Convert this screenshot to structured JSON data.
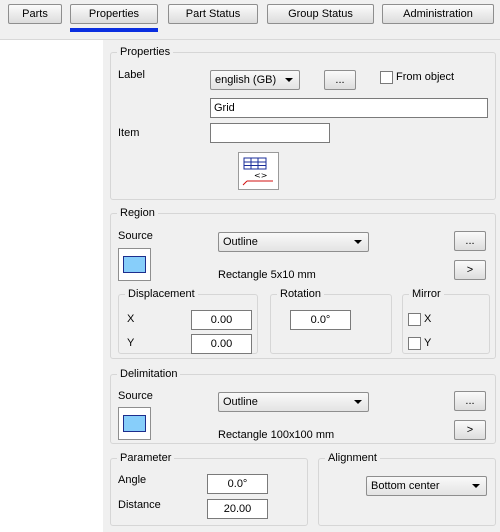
{
  "tabs": [
    {
      "label": "Parts"
    },
    {
      "label": "Properties"
    },
    {
      "label": "Part Status"
    },
    {
      "label": "Group Status"
    },
    {
      "label": "Administration"
    }
  ],
  "active_tab": "Properties",
  "properties": {
    "title": "Properties",
    "label_caption": "Label",
    "language_value": "english (GB)",
    "ellipsis_label": "...",
    "from_object_label": "From object",
    "label_value": "Grid",
    "item_caption": "Item",
    "item_value": ""
  },
  "region": {
    "title": "Region",
    "source_caption": "Source",
    "source_value": "Outline",
    "ellipsis_label": "...",
    "arrow_label": ">",
    "shape_text": "Rectangle  5x10 mm",
    "displacement": {
      "title": "Displacement",
      "x_label": "X",
      "x_value": "0.00",
      "y_label": "Y",
      "y_value": "0.00"
    },
    "rotation": {
      "title": "Rotation",
      "value": "0.0°"
    },
    "mirror": {
      "title": "Mirror",
      "x_label": "X",
      "y_label": "Y"
    }
  },
  "delimitation": {
    "title": "Delimitation",
    "source_caption": "Source",
    "source_value": "Outline",
    "ellipsis_label": "...",
    "arrow_label": ">",
    "shape_text": "Rectangle  100x100 mm"
  },
  "parameter": {
    "title": "Parameter",
    "angle_label": "Angle",
    "angle_value": "0.0°",
    "distance_label": "Distance",
    "distance_value": "20.00"
  },
  "alignment": {
    "title": "Alignment",
    "value": "Bottom center"
  },
  "colors": {
    "tab_underline": "#0a2ee0",
    "swatch_fill": "#87cefa",
    "swatch_border": "#1d2d8c"
  }
}
